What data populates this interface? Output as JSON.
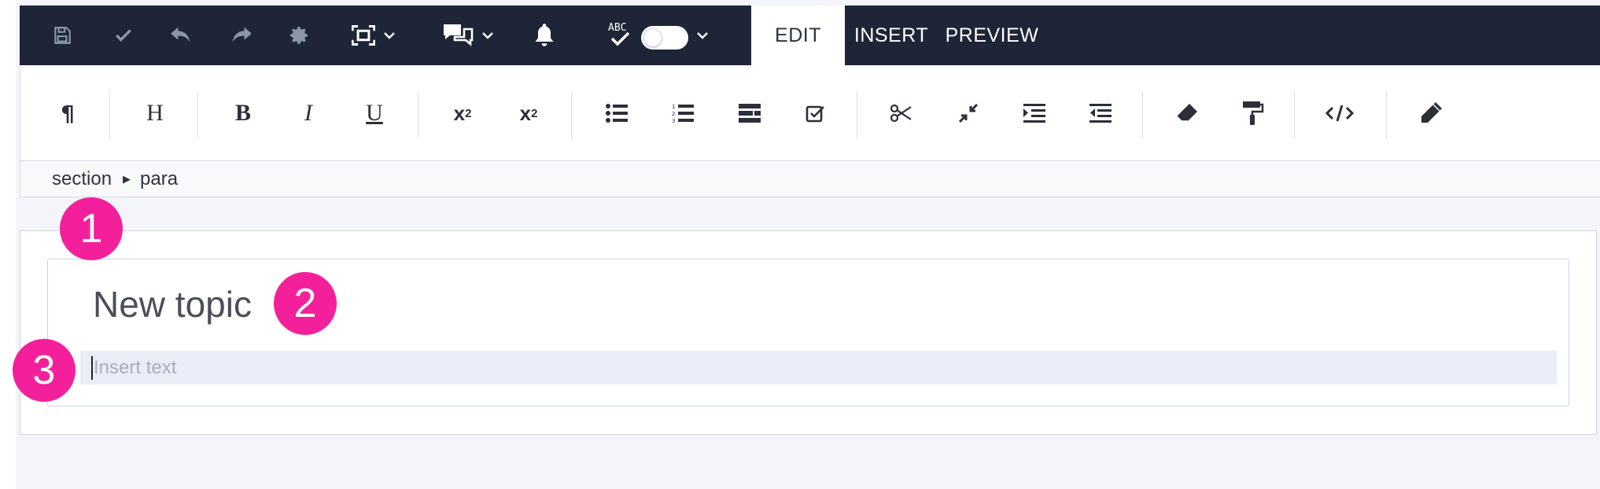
{
  "tabs": [
    {
      "label": "EDIT",
      "active": true
    },
    {
      "label": "INSERT",
      "active": false
    },
    {
      "label": "PREVIEW",
      "active": false
    }
  ],
  "toolbar_icons": [
    "save-icon",
    "check-icon",
    "undo-icon",
    "redo-icon",
    "gear-icon",
    "fullscreen-icon",
    "comments-icon",
    "bell-icon",
    "spellcheck-icon"
  ],
  "spellcheck_toggle": {
    "on": false
  },
  "format_buttons": {
    "paragraph": "¶",
    "heading": "H",
    "bold": "B",
    "italic": "I",
    "underline": "U",
    "superscript_base": "x",
    "superscript_exp": "2",
    "subscript_base": "x",
    "subscript_exp": "2"
  },
  "breadcrumb": [
    "section",
    "para"
  ],
  "document": {
    "title": "New topic",
    "para_placeholder": "Insert text"
  },
  "markers": [
    "1",
    "2",
    "3"
  ],
  "colors": {
    "topbar": "#1e2537",
    "marker": "#f4209b",
    "para_highlight": "#e9edf8"
  }
}
